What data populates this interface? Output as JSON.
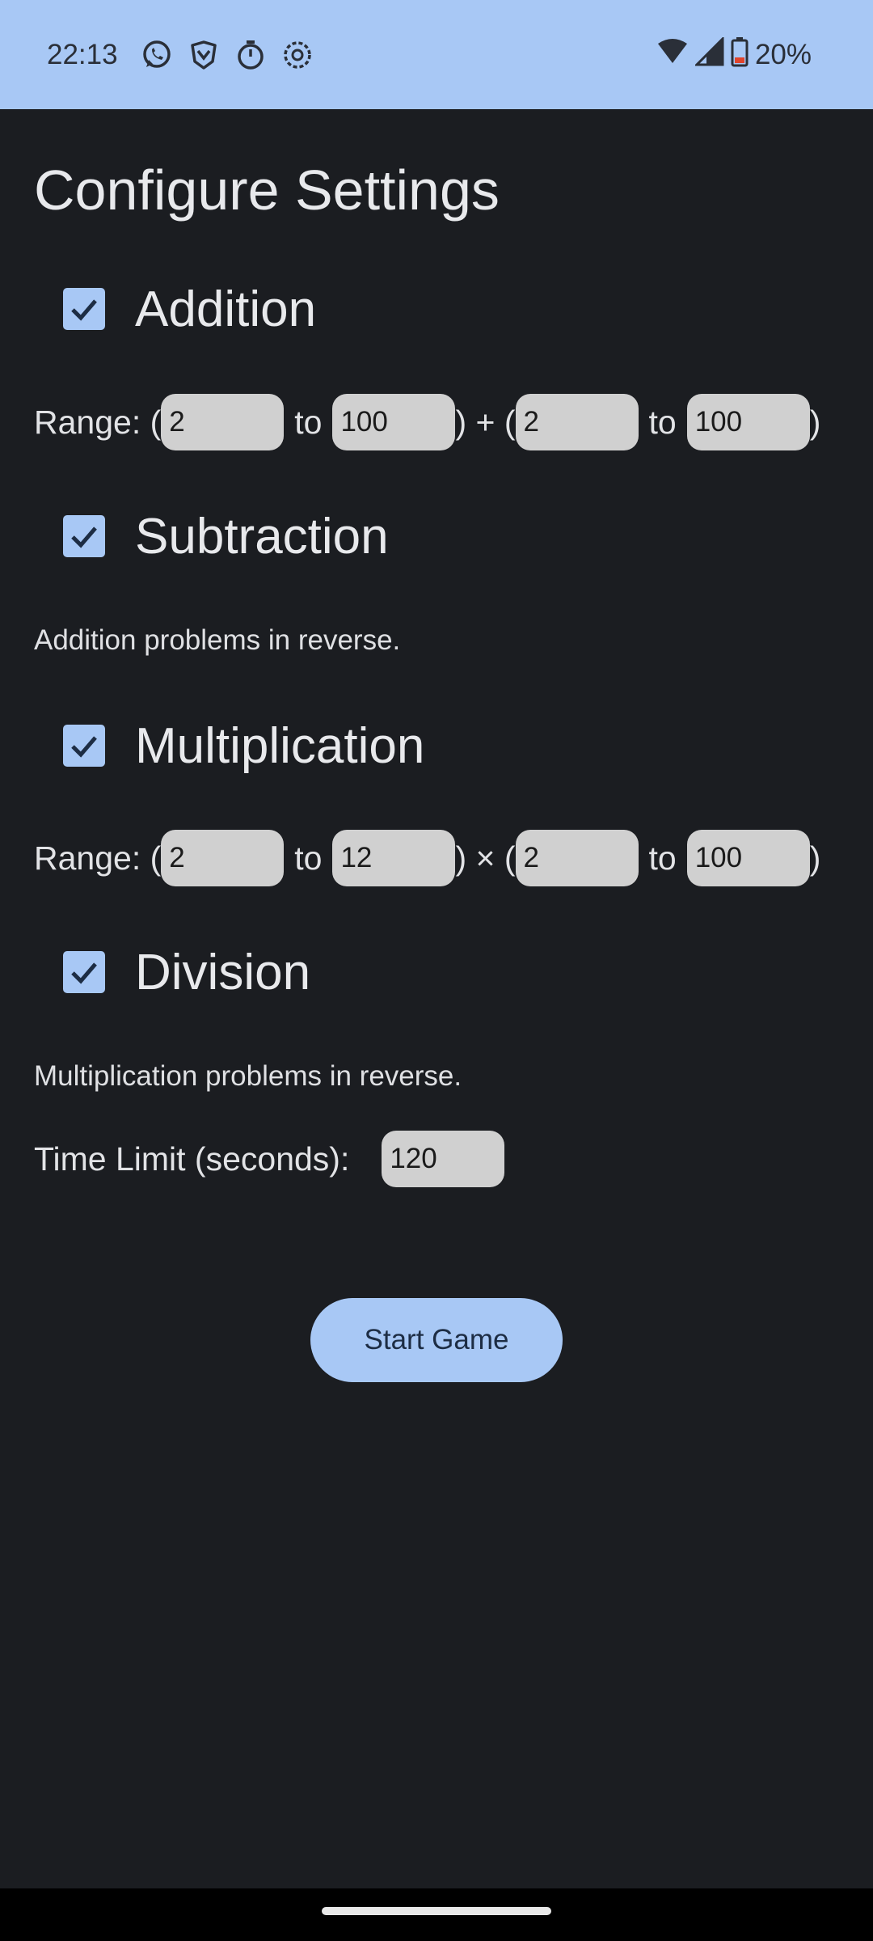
{
  "status_bar": {
    "time": "22:13",
    "notification_icons": [
      "whatsapp-icon",
      "brave-shield-icon",
      "timer-icon",
      "canvas-icon"
    ],
    "wifi_icon": "wifi-icon",
    "signal_icon": "cell-signal-icon",
    "battery_icon": "battery-icon",
    "battery": "20%"
  },
  "page": {
    "title": "Configure Settings"
  },
  "operations": {
    "addition": {
      "label": "Addition",
      "checked": true,
      "range": {
        "label": "Range: (",
        "a_min": "2",
        "to1": "to",
        "a_max": "100",
        "operator": ") + (",
        "b_min": "2",
        "to2": "to",
        "b_max": "100",
        "close": ")"
      }
    },
    "subtraction": {
      "label": "Subtraction",
      "checked": true,
      "description": "Addition problems in reverse."
    },
    "multiplication": {
      "label": "Multiplication",
      "checked": true,
      "range": {
        "label": "Range: (",
        "a_min": "2",
        "to1": "to",
        "a_max": "12",
        "operator": ") × (",
        "b_min": "2",
        "to2": "to",
        "b_max": "100",
        "close": ")"
      }
    },
    "division": {
      "label": "Division",
      "checked": true,
      "description": "Multiplication problems in reverse."
    }
  },
  "time_limit": {
    "label": "Time Limit (seconds):",
    "value": "120"
  },
  "start_button": {
    "label": "Start Game"
  },
  "colors": {
    "background": "#1b1d21",
    "status_bar": "#a8c8f5",
    "accent": "#a8c8f5",
    "input_background": "#d0d0d0",
    "text": "#e6e7ea"
  }
}
